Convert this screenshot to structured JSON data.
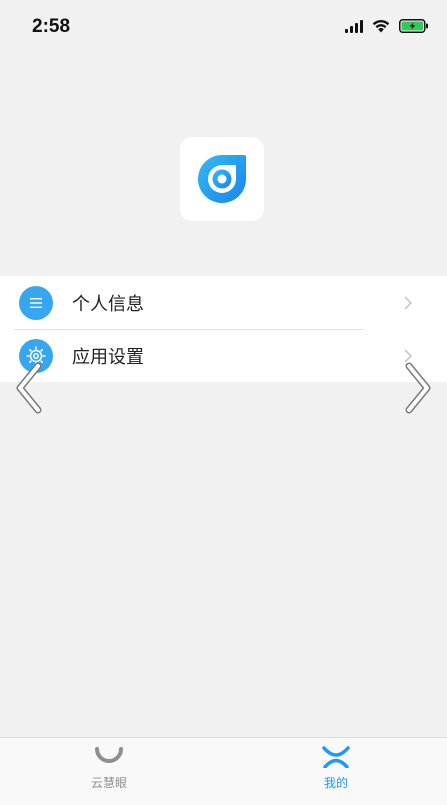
{
  "status_bar": {
    "time": "2:58"
  },
  "logo": {
    "icon": "eye-logo-icon",
    "color": "#1e9cf0"
  },
  "menu": {
    "items": [
      {
        "label": "个人信息",
        "icon": "list-icon"
      },
      {
        "label": "应用设置",
        "icon": "gear-icon"
      }
    ]
  },
  "tabs": [
    {
      "label": "云慧眼",
      "icon": "cloud-eye-tab-icon",
      "active": false
    },
    {
      "label": "我的",
      "icon": "profile-tab-icon",
      "active": true
    }
  ],
  "colors": {
    "accent": "#1d9bf0",
    "menu_icon_bg": "#36a6f1",
    "background": "#f1f1f1",
    "battery_fill": "#35c759"
  }
}
